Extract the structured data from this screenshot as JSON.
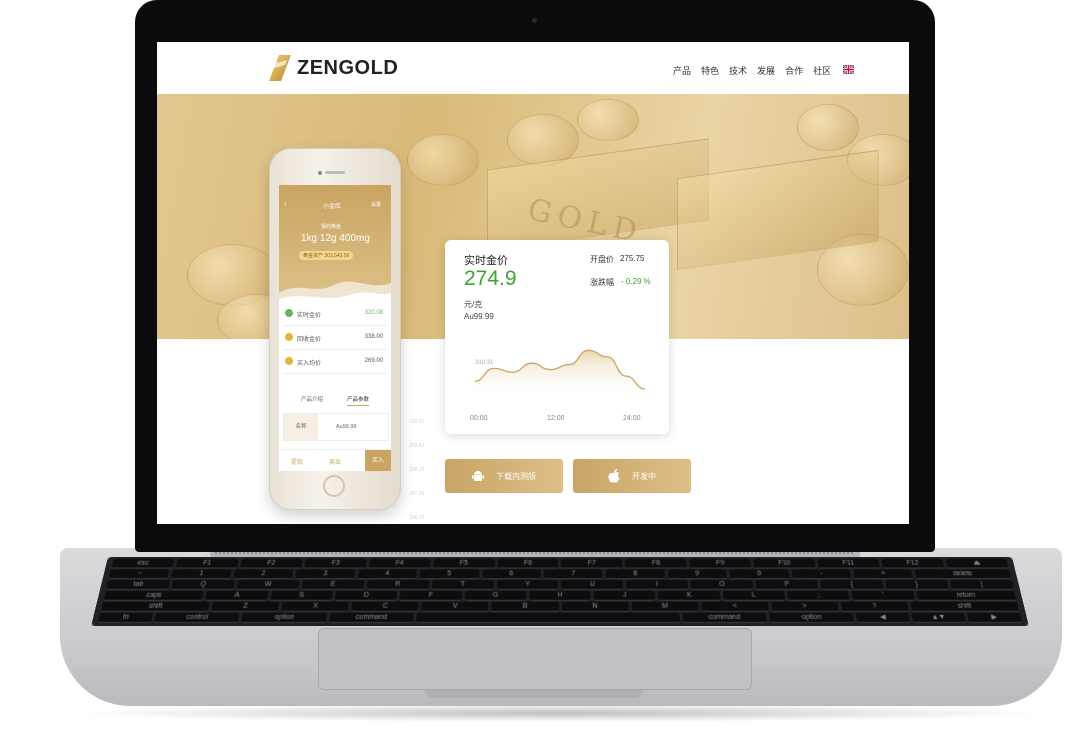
{
  "site": {
    "brand": "ZENGOLD",
    "nav": [
      "产品",
      "特色",
      "技术",
      "发展",
      "合作",
      "社区"
    ],
    "language_icon": "uk-flag-icon"
  },
  "hero": {
    "background_text": "GOLD",
    "accent_color": "#d7b77a"
  },
  "phone": {
    "title": "小金库",
    "settings": "设置",
    "label": "我的黄金",
    "amount": "1kg 12g 400mg",
    "pill": "黄金资产 303,543.56",
    "rows": [
      {
        "label": "实时金价",
        "value": "320.08",
        "color": "#6db25a"
      },
      {
        "label": "回收金价",
        "value": "338.00",
        "color": "#e4b43c"
      },
      {
        "label": "买入均价",
        "value": "269.00",
        "color": "#e4b43c"
      }
    ],
    "tabs": [
      "产品介绍",
      "产品参数"
    ],
    "table": {
      "left": "名称",
      "right": "Au99.99"
    },
    "bottom": [
      "提现",
      "卖出",
      "买入"
    ]
  },
  "price_card": {
    "title": "实时金价",
    "price": "274.9",
    "unit": "元/克",
    "grade": "Au99.99",
    "open_label": "开盘价",
    "open_value": "275.75",
    "change_label": "涨跌幅",
    "change_value": "- 0.29 %",
    "price_color": "#3aa62f"
  },
  "chart_data": {
    "type": "line",
    "x": [
      "00:00",
      "12:00",
      "24:00"
    ],
    "annotation": "310.31",
    "series": [
      {
        "values": [
          258,
          268,
          265,
          272,
          267,
          271,
          282,
          277,
          262,
          252
        ]
      }
    ],
    "grid": false
  },
  "buttons": {
    "android_label": "下载内测版",
    "apple_label": "开发中"
  },
  "background_faint": [
    "310.31",
    "309.42",
    "308.15",
    "307.26",
    "306.15"
  ],
  "keyboard": {
    "row1": [
      "esc",
      "F1",
      "F2",
      "F3",
      "F4",
      "F5",
      "F6",
      "F7",
      "F8",
      "F9",
      "F10",
      "F11",
      "F12",
      "⏏"
    ],
    "row2": [
      "~",
      "1",
      "2",
      "3",
      "4",
      "5",
      "6",
      "7",
      "8",
      "9",
      "0",
      "-",
      "+",
      "delete"
    ],
    "row3": [
      "tab",
      "Q",
      "W",
      "E",
      "R",
      "T",
      "Y",
      "U",
      "I",
      "O",
      "P",
      "{",
      "}",
      "|"
    ],
    "row4": [
      "caps",
      "A",
      "S",
      "D",
      "F",
      "G",
      "H",
      "J",
      "K",
      "L",
      ";",
      "'",
      "return"
    ],
    "row5": [
      "shift",
      "Z",
      "X",
      "C",
      "V",
      "B",
      "N",
      "M",
      "<",
      ">",
      "?",
      "shift"
    ],
    "row6": [
      "fn",
      "control",
      "option",
      "command",
      "",
      "command",
      "option",
      "◀",
      "▲▼",
      "▶"
    ]
  }
}
